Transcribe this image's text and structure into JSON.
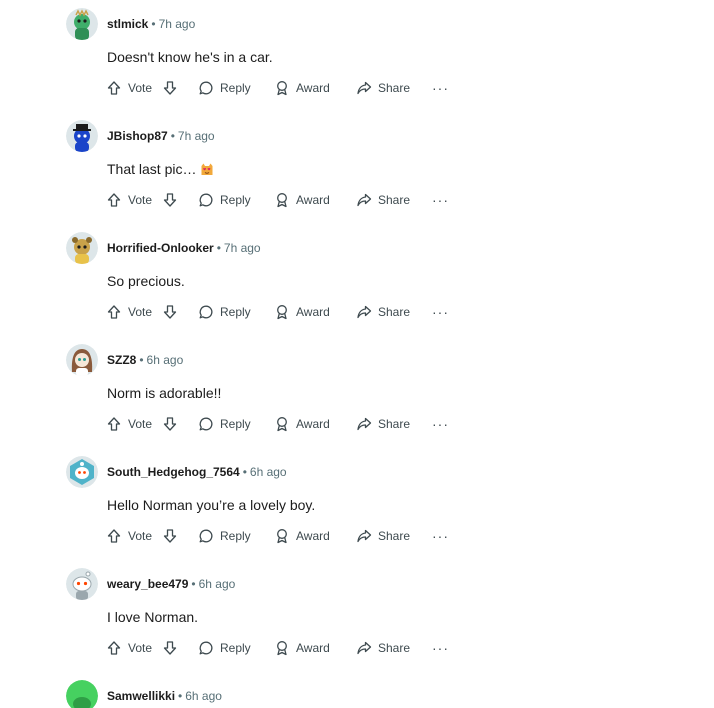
{
  "actions": {
    "vote": "Vote",
    "reply": "Reply",
    "award": "Award",
    "share": "Share",
    "more": "···"
  },
  "comments": [
    {
      "author": "stlmick",
      "time": "7h ago",
      "text": "Doesn't know he's in a car.",
      "avatar_color": "#3fae6a"
    },
    {
      "author": "JBishop87",
      "time": "7h ago",
      "text": "That last pic…",
      "avatar_color": "#1a44c9"
    },
    {
      "author": "Horrified-Onlooker",
      "time": "7h ago",
      "text": "So precious.",
      "avatar_color": "#c9a24a"
    },
    {
      "author": "SZZ8",
      "time": "6h ago",
      "text": "Norm is adorable!!",
      "avatar_color": "#8a5a3b"
    },
    {
      "author": "South_Hedgehog_7564",
      "time": "6h ago",
      "text": "Hello Norman you’re a lovely boy.",
      "avatar_color": "#4fb3c9"
    },
    {
      "author": "weary_bee479",
      "time": "6h ago",
      "text": "I love Norman.",
      "avatar_color": "#9aa7ad"
    },
    {
      "author": "Samwellikki",
      "time": "6h ago",
      "text": "",
      "avatar_color": "#46d160"
    }
  ],
  "separator": "•"
}
